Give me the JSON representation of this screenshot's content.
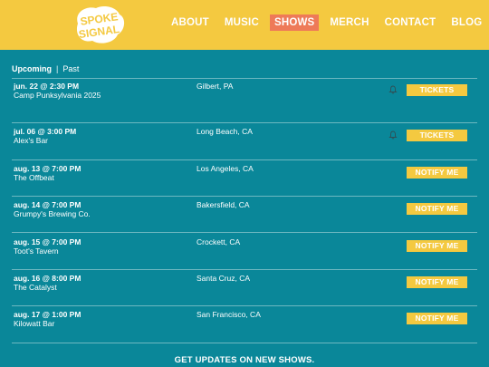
{
  "brand": {
    "logo_text": "SPOKE SIGNAL"
  },
  "nav": {
    "items": [
      {
        "label": "ABOUT"
      },
      {
        "label": "MUSIC"
      },
      {
        "label": "SHOWS",
        "active": true
      },
      {
        "label": "MERCH"
      },
      {
        "label": "CONTACT"
      },
      {
        "label": "BLOG"
      }
    ]
  },
  "filter": {
    "upcoming": "Upcoming",
    "separator": "|",
    "past": "Past"
  },
  "shows": [
    {
      "date": "jun. 22 @ 2:30 PM",
      "venue": "Camp Punksylvania 2025",
      "location": "Gilbert, PA",
      "button": "TICKETS",
      "bell": true
    },
    {
      "date": "jul. 06 @ 3:00 PM",
      "venue": "Alex's Bar",
      "location": "Long Beach, CA",
      "button": "TICKETS",
      "bell": true
    },
    {
      "date": "aug. 13 @ 7:00 PM",
      "venue": "The Offbeat",
      "location": "Los Angeles, CA",
      "button": "NOTIFY ME",
      "bell": false
    },
    {
      "date": "aug. 14 @ 7:00 PM",
      "venue": "Grumpy's Brewing Co.",
      "location": "Bakersfield, CA",
      "button": "NOTIFY ME",
      "bell": false
    },
    {
      "date": "aug. 15 @ 7:00 PM",
      "venue": "Toot's Tavern",
      "location": "Crockett, CA",
      "button": "NOTIFY ME",
      "bell": false
    },
    {
      "date": "aug. 16 @ 8:00 PM",
      "venue": "The Catalyst",
      "location": "Santa Cruz, CA",
      "button": "NOTIFY ME",
      "bell": false
    },
    {
      "date": "aug. 17 @ 1:00 PM",
      "venue": "Kilowatt Bar",
      "location": "San Francisco, CA",
      "button": "NOTIFY ME",
      "bell": false
    }
  ],
  "footer": {
    "cta": "GET UPDATES ON NEW SHOWS."
  },
  "colors": {
    "background": "#0a8799",
    "header": "#f4c940",
    "active_nav": "#ee7a58",
    "button": "#f4c940"
  }
}
